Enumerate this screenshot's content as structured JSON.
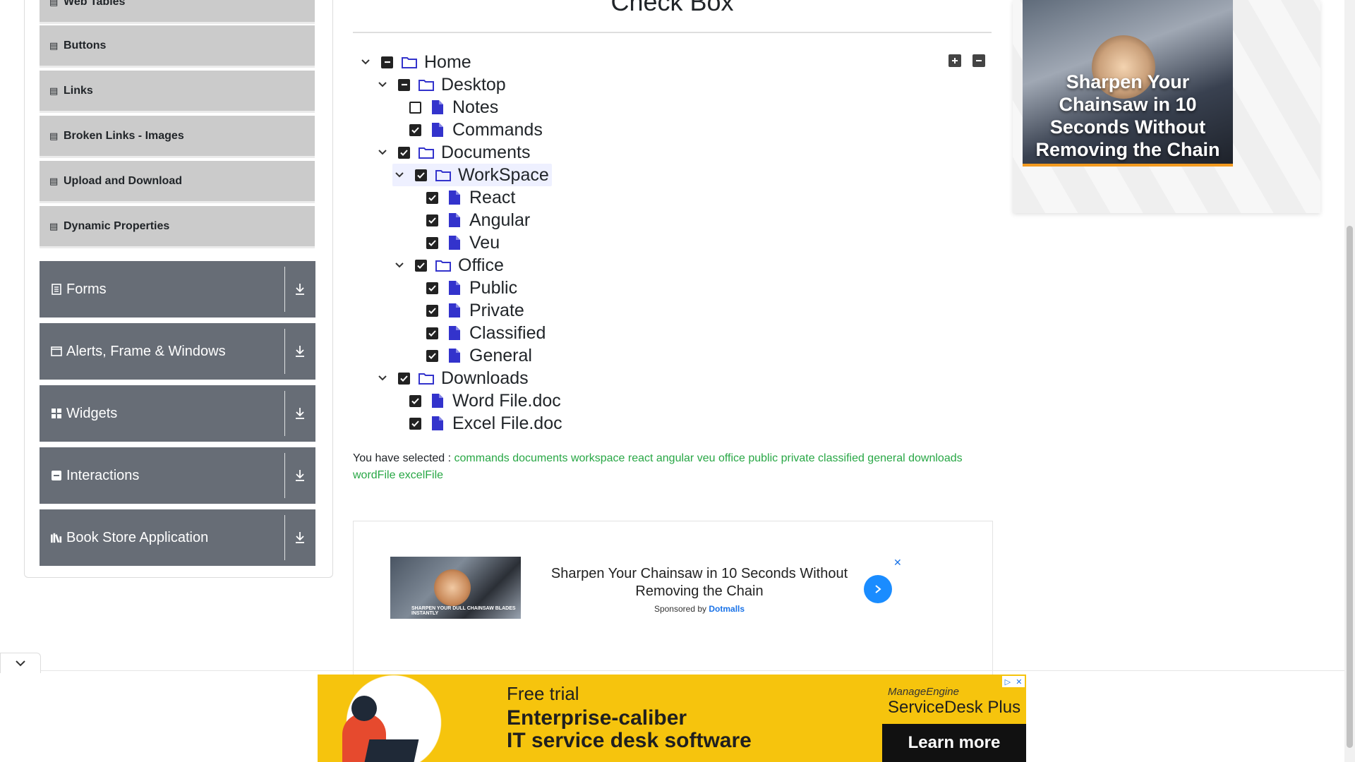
{
  "sidebar": {
    "sub_items": [
      {
        "label": "Web Tables"
      },
      {
        "label": "Buttons"
      },
      {
        "label": "Links"
      },
      {
        "label": "Broken Links - Images"
      },
      {
        "label": "Upload and Download"
      },
      {
        "label": "Dynamic Properties"
      }
    ],
    "groups": [
      {
        "label": "Forms",
        "icon": "form-icon"
      },
      {
        "label": "Alerts, Frame & Windows",
        "icon": "window-icon"
      },
      {
        "label": "Widgets",
        "icon": "grid-icon"
      },
      {
        "label": "Interactions",
        "icon": "interaction-icon"
      },
      {
        "label": "Book Store Application",
        "icon": "books-icon"
      }
    ]
  },
  "main": {
    "title": "Check Box",
    "tree": {
      "home": "Home",
      "desktop": "Desktop",
      "notes": "Notes",
      "commands": "Commands",
      "documents": "Documents",
      "workspace": "WorkSpace",
      "react": "React",
      "angular": "Angular",
      "veu": "Veu",
      "office": "Office",
      "public": "Public",
      "private": "Private",
      "classified": "Classified",
      "general": "General",
      "downloads": "Downloads",
      "word": "Word File.doc",
      "excel": "Excel File.doc"
    },
    "result_label": "You have selected :",
    "selected": "commands documents workspace react angular veu office public private classified general downloads wordFile excelFile"
  },
  "ads": {
    "inline_headline": "Sharpen Your Chainsaw in 10 Seconds Without Removing the Chain",
    "inline_sponsor_prefix": "Sponsored by",
    "inline_sponsor": "Dotmalls",
    "inline_thumb_caption": "SHARPEN YOUR DULL CHAINSAW BLADES INSTANTLY",
    "side_text": "Sharpen Your Chainsaw in 10 Seconds Without Removing the Chain",
    "banner_line1": "Free trial",
    "banner_line2": "Enterprise-caliber",
    "banner_line3": "IT service desk software",
    "banner_brand1": "ManageEngine",
    "banner_brand2": "ServiceDesk Plus",
    "banner_cta": "Learn more"
  },
  "colors": {
    "accent_blue": "#3333cc",
    "selected_green": "#28a745",
    "group_bg": "#676d76",
    "banner_yellow": "#f6c40d"
  }
}
